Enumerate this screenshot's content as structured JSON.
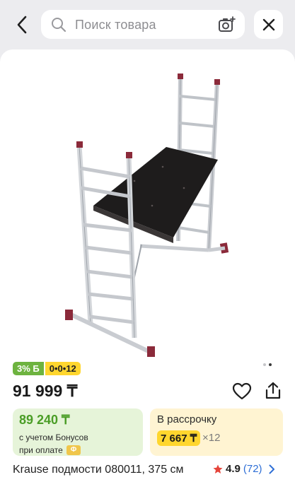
{
  "search": {
    "placeholder": "Поиск товара"
  },
  "badges": {
    "bonus": "3% Б",
    "installment": "0•0•12"
  },
  "product": {
    "price": "91 999 ₸",
    "title": "Krause подмости 080011, 375 см",
    "rating": "4.9",
    "reviews": "(72)",
    "gallery": {
      "total": 2,
      "active": 2
    }
  },
  "bonus_box": {
    "price": "89 240 ₸",
    "line1": "с учетом Бонусов",
    "line2": "при оплате",
    "icon_char": "Ф"
  },
  "credit_box": {
    "label": "В рассрочку",
    "monthly": "7 667 ₸",
    "months": "×12"
  },
  "colors": {
    "bonus_green": "#6db33f",
    "plan_yellow": "#ffd62e",
    "link_blue": "#2f6fd6",
    "star_red": "#e5443a"
  }
}
